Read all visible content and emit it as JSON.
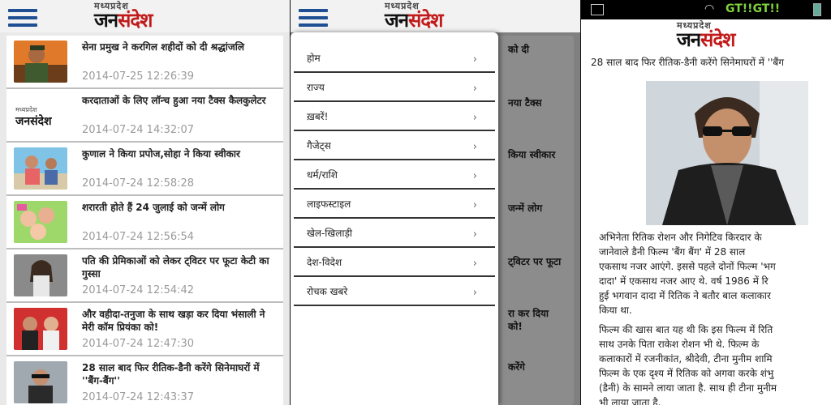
{
  "logo": {
    "top": "मध्यप्रदेश",
    "main_a": "जन",
    "main_b": "संदेश"
  },
  "news": [
    {
      "title": "सेना प्रमुख ने करगिल शहीदों को दी श्रद्धांजलि",
      "date": "2014-07-25 12:26:39"
    },
    {
      "title": "करदाताओं के लिए लॉन्च हुआ नया टैक्स कैलकुलेटर",
      "date": "2014-07-24 14:32:07"
    },
    {
      "title": "कुणाल ने किया प्रपोज,सोहा ने किया स्वीकार",
      "date": "2014-07-24 12:58:28"
    },
    {
      "title": "शरारती होते हैं 24 जुलाई को जन्में लोग",
      "date": "2014-07-24 12:56:54"
    },
    {
      "title": "पति की प्रेमिकाओं को लेकर ट्विटर पर फूटा केटी का गुस्सा",
      "date": "2014-07-24 12:54:42"
    },
    {
      "title": "और वहीदा-तनुजा के साथ खड़ा कर दिया भंसाली ने मेरी कॉम प्रियंका को!",
      "date": "2014-07-24 12:47:30"
    },
    {
      "title": "28 साल बाद फिर रीतिक-डैनी करेंगे सिनेमाघरों में ''बैंग-बैंग''",
      "date": "2014-07-24 12:43:37"
    }
  ],
  "menu": [
    "होम",
    "राज्य",
    "ख़बरें!",
    "गैजेट्स",
    "धर्म/राशि",
    "लाइफस्टाइल",
    "खेल-खिलाड़ी",
    "देश-विदेश",
    "रोचक खबरे"
  ],
  "menu_chevron": "›",
  "ghost": [
    "को दी",
    "नया टैक्स",
    "किया स्वीकार",
    "जन्में लोग",
    "ट्विटर पर फूटा",
    "रा कर दिया",
    "को!",
    "करेंगे"
  ],
  "status": {
    "carrier": "GT!!GT!!"
  },
  "article": {
    "title": "28 साल बाद फिर रीतिक-डैनी करेंगे सिनेमाघरों में ''बैंग",
    "para1": [
      "अभिनेता रितिक रोशन और निगेटिव किरदार के",
      "जानेवाले डैनी फिल्म 'बैंग बैंग' में 28 साल",
      "एकसाथ नजर आएंगे. इससे पहले दोनों फिल्म 'भग",
      "दादा' में एकसाथ नजर आए थे. वर्ष 1986 में रि",
      "हुई भगवान दादा में रितिक ने बतौर बाल कलाकार",
      "किया था."
    ],
    "para2": [
      "फिल्म की खास बात यह थी कि इस फिल्म में रिति",
      "साथ उनके पिता राकेश रोशन भी थे. फिल्म के",
      "कलाकारों में रजनीकांत, श्रीदेवी, टीना मुनीम शामि",
      "फिल्म के एक दृश्य में रितिक को अगवा करके शंभु",
      "(डैनी) के सामने लाया जाता है. साथ ही टीना मुनीम",
      "भी लाया जाता है."
    ]
  }
}
